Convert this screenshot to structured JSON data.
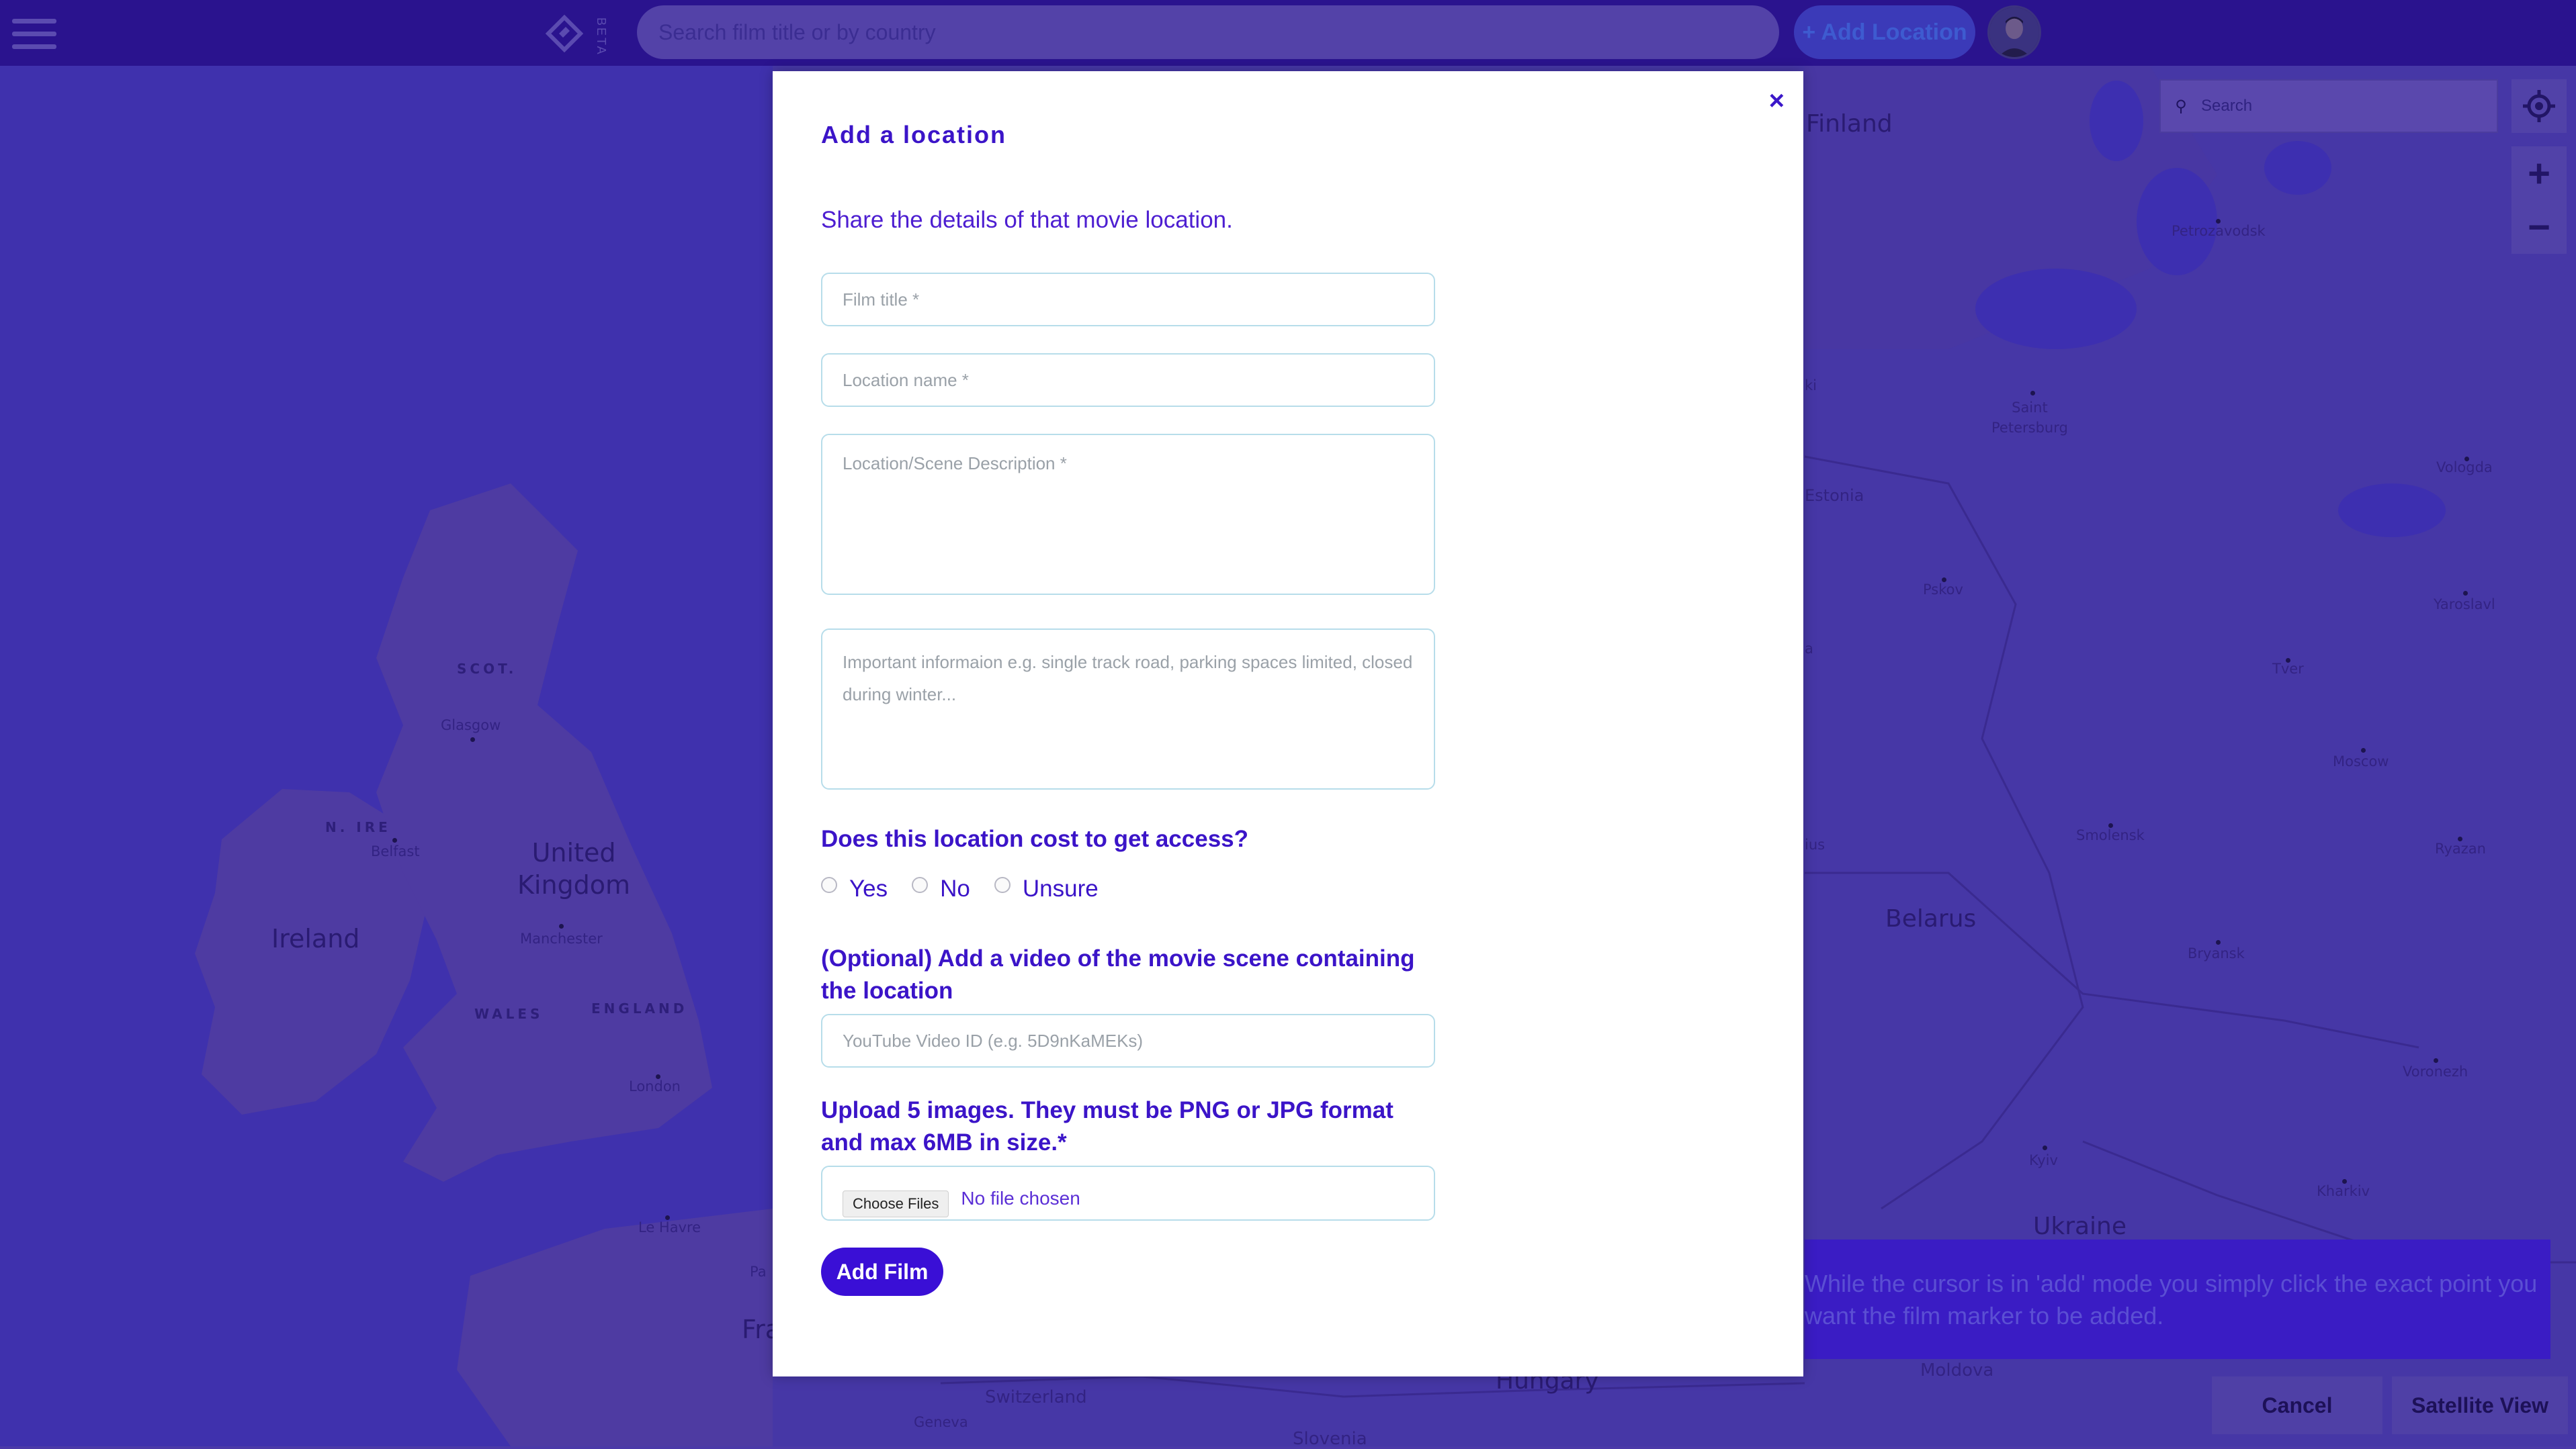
{
  "topbar": {
    "beta_label": "BETA",
    "search_placeholder": "Search film title or by country",
    "add_location_label": "+ Add Location"
  },
  "map": {
    "search_placeholder": "Search",
    "zoom_in": "+",
    "zoom_out": "−",
    "labels": {
      "finland": "Finland",
      "petrozavodsk": "Petrozavodsk",
      "saint_petersburg": "Saint\nPetersburg",
      "estonia": "Estonia",
      "vologda": "Vologda",
      "pskov": "Pskov",
      "yaroslavl": "Yaroslavl",
      "tver": "Tver",
      "moscow": "Moscow",
      "smolensk": "Smolensk",
      "ryazan": "Ryazan",
      "belarus": "Belarus",
      "bryansk": "Bryansk",
      "voronezh": "Voronezh",
      "kyiv": "Kyiv",
      "kharkiv": "Kharkiv",
      "ukraine": "Ukraine",
      "moldova": "Moldova",
      "hungary": "Hungary",
      "slovenia": "Slovenia",
      "switzerland": "Switzerland",
      "geneva": "Geneva",
      "le_havre": "Le Havre",
      "london": "London",
      "england": "ENGLAND",
      "wales": "WALES",
      "manchester": "Manchester",
      "united_kingdom": "United\nKingdom",
      "ireland": "Ireland",
      "n_ire": "N. IRE",
      "belfast": "Belfast",
      "glasgow": "Glasgow",
      "scot": "SCOT.",
      "fra": "Fra",
      "pa": "Pa",
      "ki": "ki",
      "ius": "ius",
      "a_frag": "a"
    }
  },
  "hint_text": "While the cursor is in 'add' mode you simply click the exact point you want the film marker to be added.",
  "footer": {
    "cancel_label": "Cancel",
    "satellite_label": "Satellite View"
  },
  "modal": {
    "close_label": "×",
    "title": "Add a location",
    "subtitle": "Share the details of that movie location.",
    "film_title_placeholder": "Film title *",
    "location_name_placeholder": "Location name *",
    "description_placeholder": "Location/Scene Description *",
    "info_placeholder": "Important informaion e.g. single track road, parking spaces limited, closed during winter...",
    "cost_question": "Does this location cost to get access?",
    "cost_options": [
      "Yes",
      "No",
      "Unsure"
    ],
    "video_question": "(Optional) Add a video of the movie scene containing the location",
    "video_placeholder": "YouTube Video ID (e.g. 5D9nKaMEKs)",
    "upload_question": "Upload 5 images. They must be PNG or JPG format and max 6MB in size.*",
    "choose_files_label": "Choose Files",
    "no_file_label": "No file chosen",
    "submit_label": "Add Film"
  },
  "colors": {
    "topbar": "#2a138e",
    "map_land": "#4b39a8",
    "map_water": "#3d2fb0",
    "accent": "#3a0fd6",
    "modal_text": "#3b14c8"
  }
}
